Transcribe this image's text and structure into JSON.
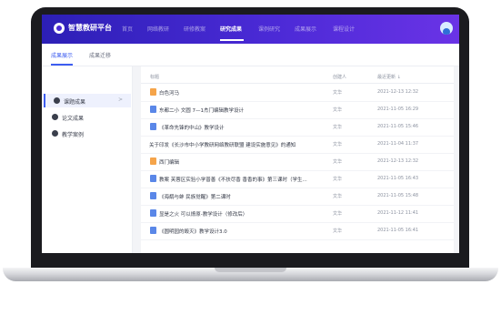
{
  "header": {
    "brand": "智慧教研平台",
    "nav": [
      {
        "label": "首页",
        "active": false
      },
      {
        "label": "网络教研",
        "active": false
      },
      {
        "label": "研修教案",
        "active": false
      },
      {
        "label": "研究成果",
        "active": true
      },
      {
        "label": "课例研究",
        "active": false
      },
      {
        "label": "成果展示",
        "active": false
      },
      {
        "label": "课程设计",
        "active": false
      }
    ]
  },
  "subtabs": [
    {
      "label": "成果展示",
      "active": true
    },
    {
      "label": "成果迁移",
      "active": false
    }
  ],
  "sidebar": {
    "items": [
      {
        "label": "课题成果",
        "active": true,
        "chevron": ">"
      },
      {
        "label": "论文成果",
        "active": false,
        "chevron": ""
      },
      {
        "label": "教学案例",
        "active": false,
        "chevron": ""
      }
    ]
  },
  "table": {
    "headers": {
      "name": "标题",
      "creator": "创建人",
      "date": "最近更新 ↓"
    },
    "rows": [
      {
        "icon": "img",
        "name": "白色河马",
        "creator": "文华",
        "date": "2021-12-13 12:32"
      },
      {
        "icon": "doc",
        "name": "东都二小 文圆 7—1杰门编辑教学设计",
        "creator": "文华",
        "date": "2021-11-05 16:29"
      },
      {
        "icon": "doc",
        "name": "《革命先锋的中山》教学设计",
        "creator": "文华",
        "date": "2021-11-05 15:46"
      },
      {
        "icon": "none",
        "name": "关于印发《长沙市中小学教研网络教研联盟 建设实施意见》的通知",
        "creator": "文华",
        "date": "2021-11-04 11:37"
      },
      {
        "icon": "img",
        "name": "西门编辑",
        "creator": "文华",
        "date": "2021-12-13 12:32"
      },
      {
        "icon": "doc",
        "name": "教案 芙蓉区实验小学普善《不扶尽香 香香的事》第三课时（学生...",
        "creator": "文华",
        "date": "2021-11-05 16:43"
      },
      {
        "icon": "doc",
        "name": "《海鹬与蚌 民族觉醒》第二课时",
        "creator": "文华",
        "date": "2021-11-05 15:48"
      },
      {
        "icon": "doc",
        "name": "显是之火 可以燎原-教学设计（修改后）",
        "creator": "文华",
        "date": "2021-11-12 11:41"
      },
      {
        "icon": "doc",
        "name": "《圆明园的毁灭》教学设计3.0",
        "creator": "文华",
        "date": "2021-11-05 16:41"
      }
    ]
  }
}
